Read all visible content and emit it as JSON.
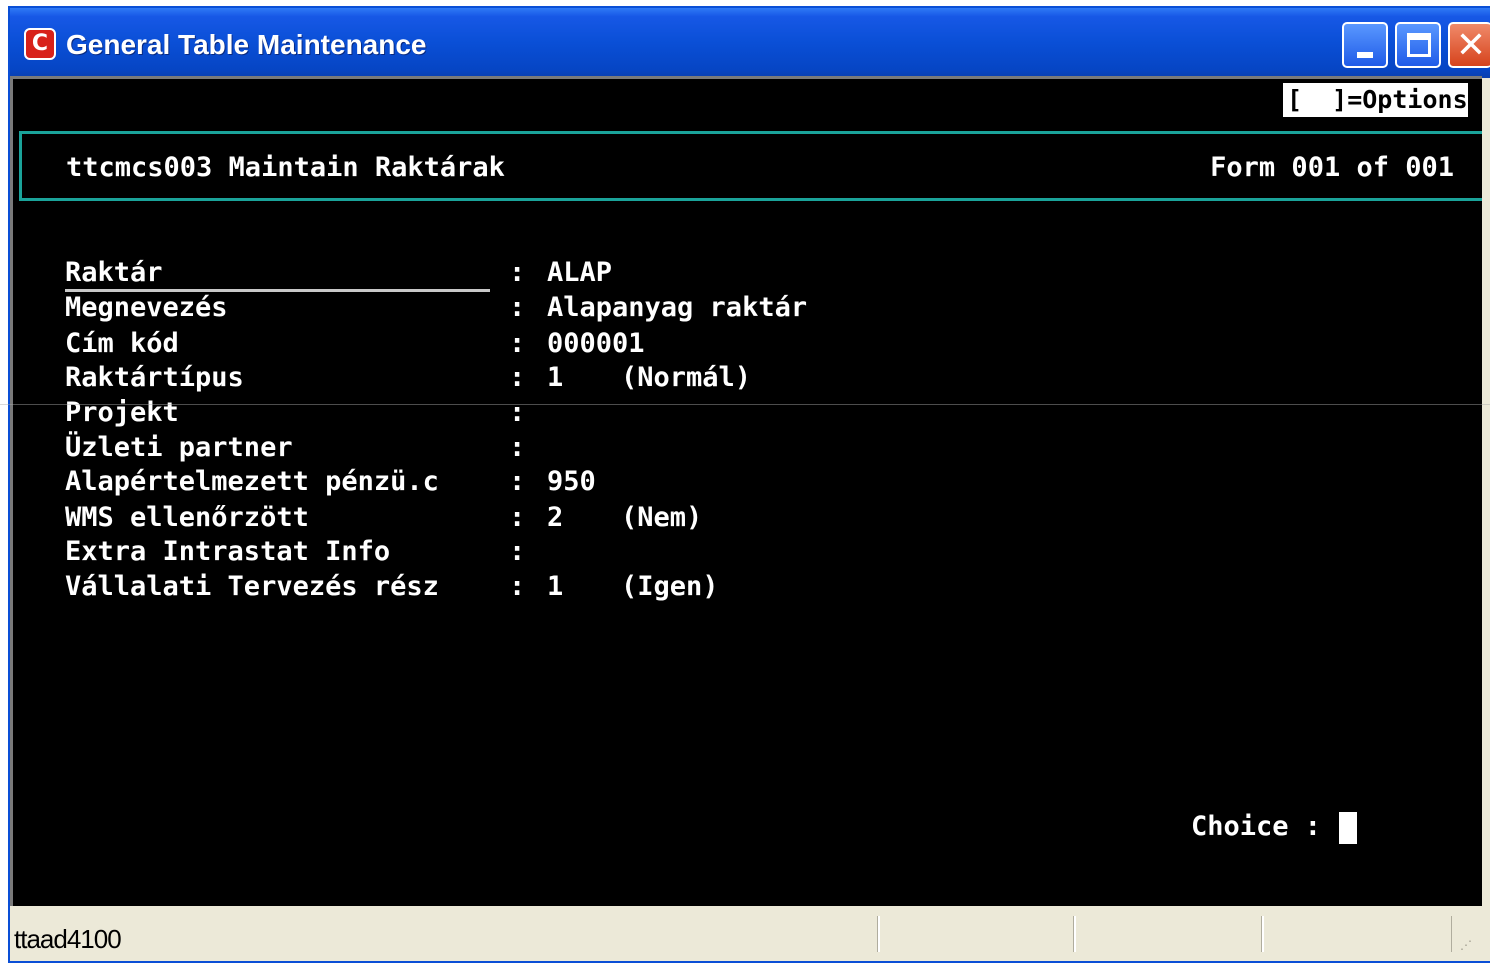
{
  "window": {
    "title": "General Table Maintenance",
    "app_icon_glyph": "C",
    "controls": {
      "minimize": "minimize-icon",
      "maximize": "maximize-icon",
      "close": "close-icon",
      "close_glyph": "✕"
    }
  },
  "terminal": {
    "options_label": "[  ]=Options",
    "session_title": "ttcmcs003 Maintain Raktárak",
    "form_indicator": "Form 001 of 001",
    "fields": [
      {
        "label": "Raktár",
        "colon": ":",
        "value": "ALAP",
        "desc": ""
      },
      {
        "label": "Megnevezés",
        "colon": ":",
        "value": "Alapanyag raktár",
        "desc": ""
      },
      {
        "label": "Cím kód",
        "colon": ":",
        "value": "000001",
        "desc": ""
      },
      {
        "label": "Raktártípus",
        "colon": ":",
        "value": "1",
        "desc": "(Normál)"
      },
      {
        "label": "Projekt",
        "colon": ":",
        "value": "",
        "desc": ""
      },
      {
        "label": "Üzleti partner",
        "colon": ":",
        "value": "",
        "desc": ""
      },
      {
        "label": "Alapértelmezett pénzü.c",
        "colon": ":",
        "value": "950",
        "desc": ""
      },
      {
        "label": "WMS ellenőrzött",
        "colon": ":",
        "value": "2",
        "desc": "(Nem)"
      },
      {
        "label": "Extra Intrastat Info",
        "colon": ":",
        "value": "",
        "desc": ""
      },
      {
        "label": "Vállalati Tervezés rész",
        "colon": ":",
        "value": "1",
        "desc": "(Igen)"
      }
    ],
    "choice_label": "Choice :"
  },
  "statusbar": {
    "session_id": "ttaad4100"
  },
  "colors": {
    "titlebar": "#0a4fd6",
    "terminal_bg": "#000000",
    "terminal_text": "#ffffff",
    "header_border": "#1aa39a"
  }
}
